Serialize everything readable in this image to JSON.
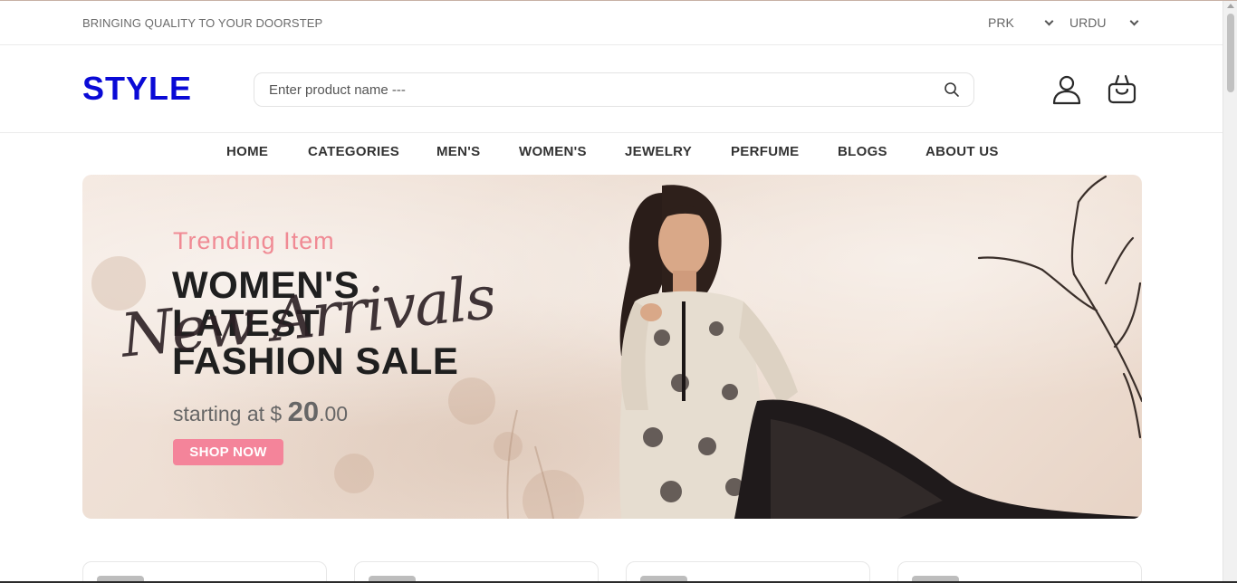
{
  "top_bar": {
    "tagline": "BRINGING QUALITY TO YOUR DOORSTEP",
    "currency": "PRK",
    "language": "URDU"
  },
  "header": {
    "logo": "STYLE",
    "search_placeholder": "Enter product name ---",
    "icons": [
      "search-icon",
      "user-icon",
      "shopping-bag-icon"
    ]
  },
  "nav": {
    "items": [
      "HOME",
      "CATEGORIES",
      "MEN'S",
      "WOMEN'S",
      "JEWELRY",
      "PERFUME",
      "BLOGS",
      "ABOUT US"
    ]
  },
  "banner": {
    "subtitle": "Trending Item",
    "title_line1": "WOMEN'S",
    "title_line2": "LATEST",
    "title_line3": "FASHION SALE",
    "script_text": "New Arrivals",
    "price_prefix": "starting at $",
    "price_whole": "20",
    "price_cents": ".00",
    "cta": "SHOP NOW"
  },
  "colors": {
    "logo": "#0a0ad6",
    "accent_pink": "#f4849a",
    "trending_pink": "#f08a94",
    "text_dark": "#333333"
  }
}
